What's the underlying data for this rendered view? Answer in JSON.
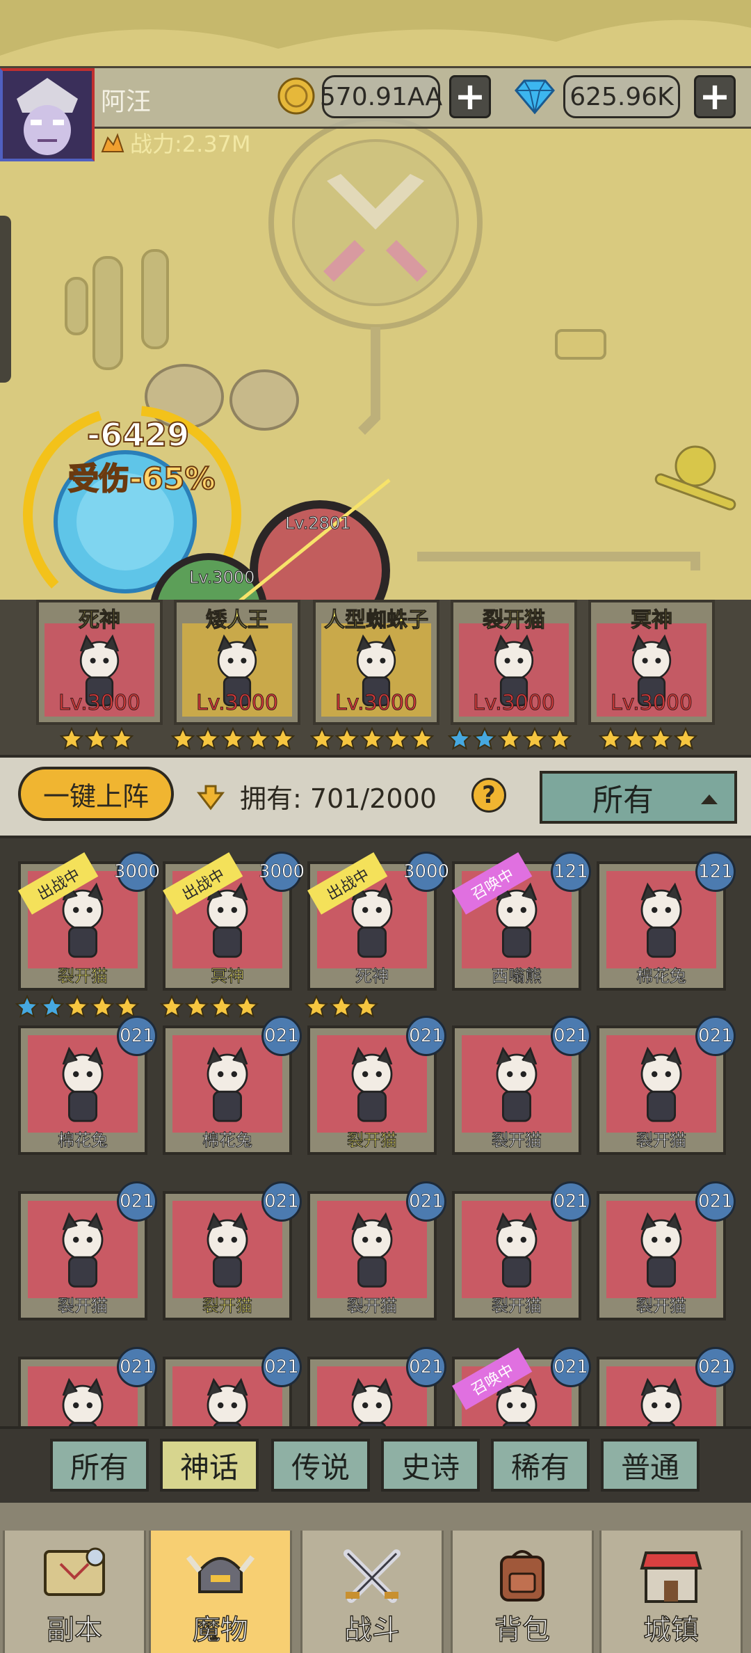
{
  "player": {
    "name": "阿汪",
    "power_label": "战力:2.37M",
    "gold": "570.91AA",
    "gems": "625.96K",
    "add_gold_label": "+",
    "add_gems_label": "+"
  },
  "battle": {
    "damage": "-6429",
    "damage_reduction": "受伤-65%",
    "enemy_level": "Lv.2801",
    "ally_level": "Lv.3000"
  },
  "formation": [
    {
      "name": "死神",
      "level": "Lv.3000",
      "stars": [
        "gold",
        "gold",
        "gold"
      ]
    },
    {
      "name": "矮人王",
      "level": "Lv.3000",
      "stars": [
        "gold",
        "gold",
        "gold",
        "gold",
        "gold"
      ]
    },
    {
      "name": "人型蜘蛛子",
      "level": "Lv.3000",
      "stars": [
        "gold",
        "gold",
        "gold",
        "gold",
        "gold"
      ]
    },
    {
      "name": "裂开猫",
      "level": "Lv.3000",
      "stars": [
        "blue",
        "blue",
        "gold",
        "gold",
        "gold"
      ]
    },
    {
      "name": "冥神",
      "level": "Lv.3000",
      "stars": [
        "gold",
        "gold",
        "gold",
        "gold"
      ]
    }
  ],
  "controls": {
    "auto_deploy": "一键上阵",
    "own_label": "拥有:",
    "own_count": "701/2000",
    "help": "?",
    "filter": "所有"
  },
  "grid": [
    {
      "name": "裂开猫",
      "level": "3000",
      "tag": "出战中",
      "gold": true,
      "stars": [
        "blue",
        "blue",
        "gold",
        "gold",
        "gold"
      ]
    },
    {
      "name": "冥神",
      "level": "3000",
      "tag": "出战中",
      "gold": true,
      "stars": [
        "gold",
        "gold",
        "gold",
        "gold"
      ]
    },
    {
      "name": "死神",
      "level": "3000",
      "tag": "出战中",
      "gold": false,
      "stars": [
        "gold",
        "gold",
        "gold"
      ]
    },
    {
      "name": "西嗡熊",
      "level": "121",
      "tag": "召唤中",
      "gold": false,
      "stars": []
    },
    {
      "name": "棉花兔",
      "level": "121",
      "tag": "",
      "gold": false,
      "stars": []
    },
    {
      "name": "棉花兔",
      "level": "021",
      "tag": "",
      "gold": false,
      "stars": []
    },
    {
      "name": "棉花兔",
      "level": "021",
      "tag": "",
      "gold": false,
      "stars": []
    },
    {
      "name": "裂开猫",
      "level": "021",
      "tag": "",
      "gold": true,
      "stars": []
    },
    {
      "name": "裂开猫",
      "level": "021",
      "tag": "",
      "gold": false,
      "stars": []
    },
    {
      "name": "裂开猫",
      "level": "021",
      "tag": "",
      "gold": false,
      "stars": []
    },
    {
      "name": "裂开猫",
      "level": "021",
      "tag": "",
      "gold": false,
      "stars": []
    },
    {
      "name": "裂开猫",
      "level": "021",
      "tag": "",
      "gold": true,
      "stars": []
    },
    {
      "name": "裂开猫",
      "level": "021",
      "tag": "",
      "gold": false,
      "stars": []
    },
    {
      "name": "裂开猫",
      "level": "021",
      "tag": "",
      "gold": false,
      "stars": []
    },
    {
      "name": "裂开猫",
      "level": "021",
      "tag": "",
      "gold": false,
      "stars": []
    },
    {
      "name": "",
      "level": "021",
      "tag": "",
      "gold": false,
      "stars": []
    },
    {
      "name": "",
      "level": "021",
      "tag": "",
      "gold": false,
      "stars": []
    },
    {
      "name": "",
      "level": "021",
      "tag": "",
      "gold": false,
      "stars": []
    },
    {
      "name": "",
      "level": "021",
      "tag": "召唤中",
      "gold": false,
      "stars": []
    },
    {
      "name": "",
      "level": "021",
      "tag": "",
      "gold": false,
      "stars": []
    }
  ],
  "rarity_tabs": [
    {
      "label": "所有",
      "active": false
    },
    {
      "label": "神话",
      "active": true
    },
    {
      "label": "传说",
      "active": false
    },
    {
      "label": "史诗",
      "active": false
    },
    {
      "label": "稀有",
      "active": false
    },
    {
      "label": "普通",
      "active": false
    }
  ],
  "nav": [
    {
      "label": "副本",
      "icon": "map-icon",
      "active": false
    },
    {
      "label": "魔物",
      "icon": "monster-helmet-icon",
      "active": true
    },
    {
      "label": "战斗",
      "icon": "crossed-swords-icon",
      "active": false
    },
    {
      "label": "背包",
      "icon": "backpack-icon",
      "active": false
    },
    {
      "label": "城镇",
      "icon": "town-shop-icon",
      "active": false
    }
  ],
  "colors": {
    "accent_gold": "#f0b531",
    "star_gold": "#f6c640",
    "star_blue": "#46a8e0",
    "card_red": "#c95a64",
    "active_tab": "#d7d58e",
    "tab": "#8fb0a4"
  }
}
